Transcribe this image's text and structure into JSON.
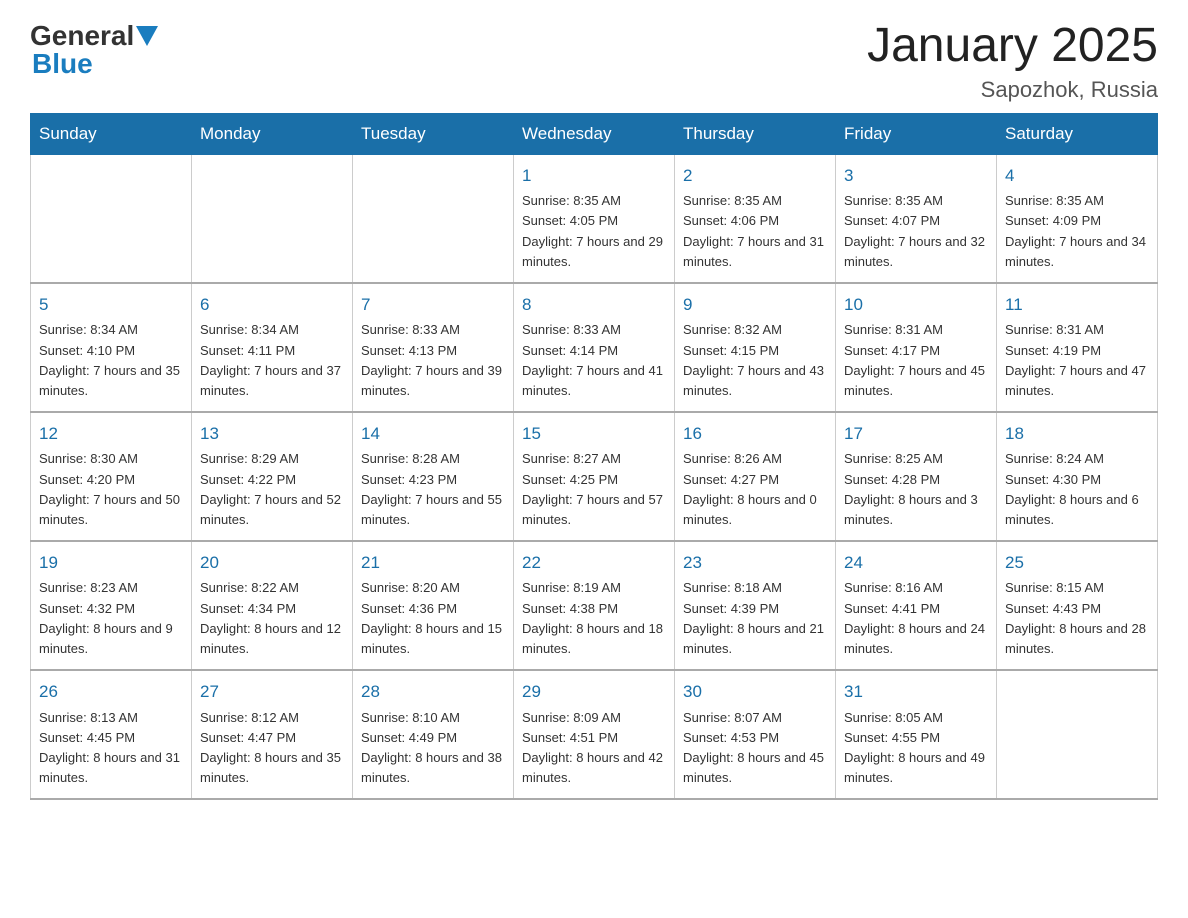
{
  "header": {
    "title": "January 2025",
    "subtitle": "Sapozhok, Russia",
    "logo_general": "General",
    "logo_blue": "Blue"
  },
  "days_of_week": [
    "Sunday",
    "Monday",
    "Tuesday",
    "Wednesday",
    "Thursday",
    "Friday",
    "Saturday"
  ],
  "weeks": [
    [
      {
        "day": "",
        "info": ""
      },
      {
        "day": "",
        "info": ""
      },
      {
        "day": "",
        "info": ""
      },
      {
        "day": "1",
        "info": "Sunrise: 8:35 AM\nSunset: 4:05 PM\nDaylight: 7 hours\nand 29 minutes."
      },
      {
        "day": "2",
        "info": "Sunrise: 8:35 AM\nSunset: 4:06 PM\nDaylight: 7 hours\nand 31 minutes."
      },
      {
        "day": "3",
        "info": "Sunrise: 8:35 AM\nSunset: 4:07 PM\nDaylight: 7 hours\nand 32 minutes."
      },
      {
        "day": "4",
        "info": "Sunrise: 8:35 AM\nSunset: 4:09 PM\nDaylight: 7 hours\nand 34 minutes."
      }
    ],
    [
      {
        "day": "5",
        "info": "Sunrise: 8:34 AM\nSunset: 4:10 PM\nDaylight: 7 hours\nand 35 minutes."
      },
      {
        "day": "6",
        "info": "Sunrise: 8:34 AM\nSunset: 4:11 PM\nDaylight: 7 hours\nand 37 minutes."
      },
      {
        "day": "7",
        "info": "Sunrise: 8:33 AM\nSunset: 4:13 PM\nDaylight: 7 hours\nand 39 minutes."
      },
      {
        "day": "8",
        "info": "Sunrise: 8:33 AM\nSunset: 4:14 PM\nDaylight: 7 hours\nand 41 minutes."
      },
      {
        "day": "9",
        "info": "Sunrise: 8:32 AM\nSunset: 4:15 PM\nDaylight: 7 hours\nand 43 minutes."
      },
      {
        "day": "10",
        "info": "Sunrise: 8:31 AM\nSunset: 4:17 PM\nDaylight: 7 hours\nand 45 minutes."
      },
      {
        "day": "11",
        "info": "Sunrise: 8:31 AM\nSunset: 4:19 PM\nDaylight: 7 hours\nand 47 minutes."
      }
    ],
    [
      {
        "day": "12",
        "info": "Sunrise: 8:30 AM\nSunset: 4:20 PM\nDaylight: 7 hours\nand 50 minutes."
      },
      {
        "day": "13",
        "info": "Sunrise: 8:29 AM\nSunset: 4:22 PM\nDaylight: 7 hours\nand 52 minutes."
      },
      {
        "day": "14",
        "info": "Sunrise: 8:28 AM\nSunset: 4:23 PM\nDaylight: 7 hours\nand 55 minutes."
      },
      {
        "day": "15",
        "info": "Sunrise: 8:27 AM\nSunset: 4:25 PM\nDaylight: 7 hours\nand 57 minutes."
      },
      {
        "day": "16",
        "info": "Sunrise: 8:26 AM\nSunset: 4:27 PM\nDaylight: 8 hours\nand 0 minutes."
      },
      {
        "day": "17",
        "info": "Sunrise: 8:25 AM\nSunset: 4:28 PM\nDaylight: 8 hours\nand 3 minutes."
      },
      {
        "day": "18",
        "info": "Sunrise: 8:24 AM\nSunset: 4:30 PM\nDaylight: 8 hours\nand 6 minutes."
      }
    ],
    [
      {
        "day": "19",
        "info": "Sunrise: 8:23 AM\nSunset: 4:32 PM\nDaylight: 8 hours\nand 9 minutes."
      },
      {
        "day": "20",
        "info": "Sunrise: 8:22 AM\nSunset: 4:34 PM\nDaylight: 8 hours\nand 12 minutes."
      },
      {
        "day": "21",
        "info": "Sunrise: 8:20 AM\nSunset: 4:36 PM\nDaylight: 8 hours\nand 15 minutes."
      },
      {
        "day": "22",
        "info": "Sunrise: 8:19 AM\nSunset: 4:38 PM\nDaylight: 8 hours\nand 18 minutes."
      },
      {
        "day": "23",
        "info": "Sunrise: 8:18 AM\nSunset: 4:39 PM\nDaylight: 8 hours\nand 21 minutes."
      },
      {
        "day": "24",
        "info": "Sunrise: 8:16 AM\nSunset: 4:41 PM\nDaylight: 8 hours\nand 24 minutes."
      },
      {
        "day": "25",
        "info": "Sunrise: 8:15 AM\nSunset: 4:43 PM\nDaylight: 8 hours\nand 28 minutes."
      }
    ],
    [
      {
        "day": "26",
        "info": "Sunrise: 8:13 AM\nSunset: 4:45 PM\nDaylight: 8 hours\nand 31 minutes."
      },
      {
        "day": "27",
        "info": "Sunrise: 8:12 AM\nSunset: 4:47 PM\nDaylight: 8 hours\nand 35 minutes."
      },
      {
        "day": "28",
        "info": "Sunrise: 8:10 AM\nSunset: 4:49 PM\nDaylight: 8 hours\nand 38 minutes."
      },
      {
        "day": "29",
        "info": "Sunrise: 8:09 AM\nSunset: 4:51 PM\nDaylight: 8 hours\nand 42 minutes."
      },
      {
        "day": "30",
        "info": "Sunrise: 8:07 AM\nSunset: 4:53 PM\nDaylight: 8 hours\nand 45 minutes."
      },
      {
        "day": "31",
        "info": "Sunrise: 8:05 AM\nSunset: 4:55 PM\nDaylight: 8 hours\nand 49 minutes."
      },
      {
        "day": "",
        "info": ""
      }
    ]
  ]
}
